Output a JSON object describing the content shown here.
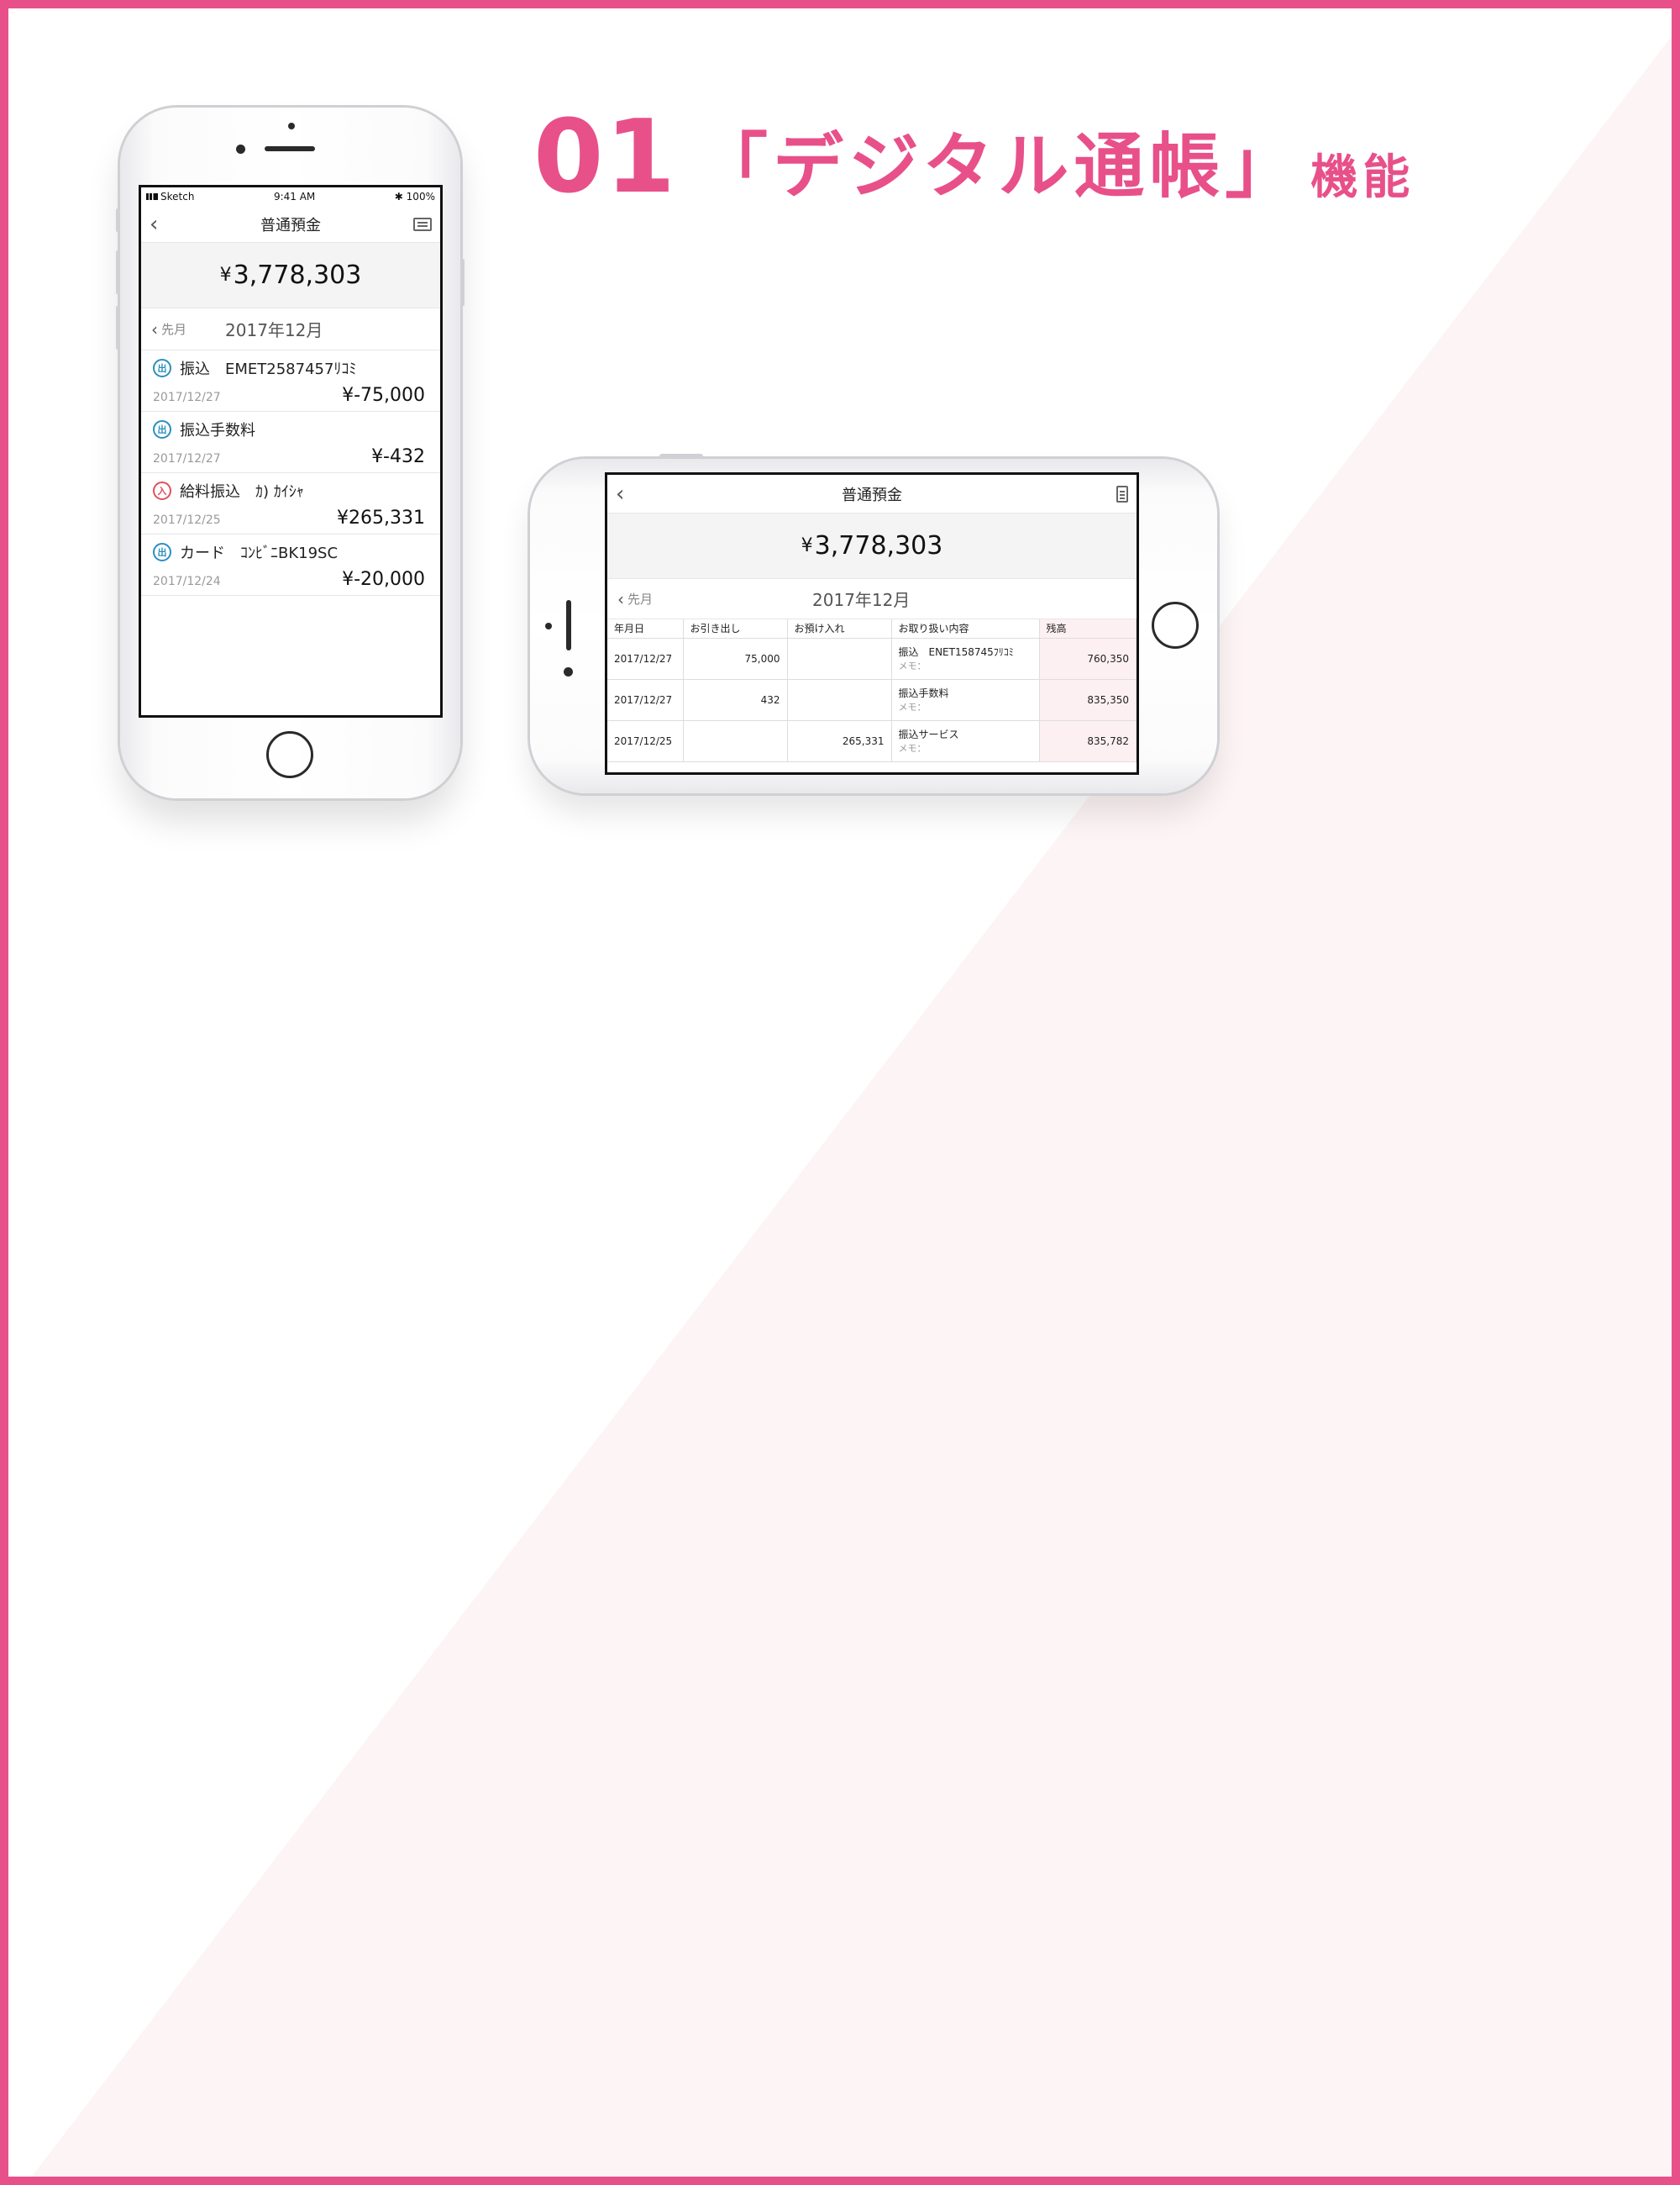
{
  "heading": {
    "number": "01",
    "title": "「デジタル通帳」",
    "suffix": "機能"
  },
  "colors": {
    "accent": "#e8508a",
    "bg_tint": "#fdf4f5",
    "incoming": "#e0505e",
    "outgoing": "#2a8fc0"
  },
  "portrait": {
    "status": {
      "carrier": "Sketch",
      "time": "9:41 AM",
      "battery": "100%"
    },
    "nav_title": "普通預金",
    "balance_symbol": "¥",
    "balance_value": "3,778,303",
    "prev_label": "先月",
    "month": "2017年12月",
    "transactions": [
      {
        "badge": "出",
        "desc": "振込　EMET2587457ﾘｺﾐ",
        "date": "2017/12/27",
        "amount": "¥-75,000"
      },
      {
        "badge": "出",
        "desc": "振込手数料",
        "date": "2017/12/27",
        "amount": "¥-432"
      },
      {
        "badge": "入",
        "desc": "給料振込　ｶ) ｶｲｼｬ",
        "date": "2017/12/25",
        "amount": "¥265,331"
      },
      {
        "badge": "出",
        "desc": "カード　ｺﾝﾋﾞﾆBK19SC",
        "date": "2017/12/24",
        "amount": "¥-20,000"
      }
    ]
  },
  "landscape": {
    "nav_title": "普通預金",
    "balance_symbol": "¥",
    "balance_value": "3,778,303",
    "prev_label": "先月",
    "month": "2017年12月",
    "columns": [
      "年月日",
      "お引き出し",
      "お預け入れ",
      "お取り扱い内容",
      "残高"
    ],
    "memo_label": "メモ：",
    "rows": [
      {
        "date": "2017/12/27",
        "withdraw": "75,000",
        "deposit": "",
        "desc": "振込　ENET158745ﾌﾘｺﾐ",
        "balance": "760,350"
      },
      {
        "date": "2017/12/27",
        "withdraw": "432",
        "deposit": "",
        "desc": "振込手数料",
        "balance": "835,350"
      },
      {
        "date": "2017/12/25",
        "withdraw": "",
        "deposit": "265,331",
        "desc": "振込サービス",
        "balance": "835,782"
      }
    ]
  }
}
